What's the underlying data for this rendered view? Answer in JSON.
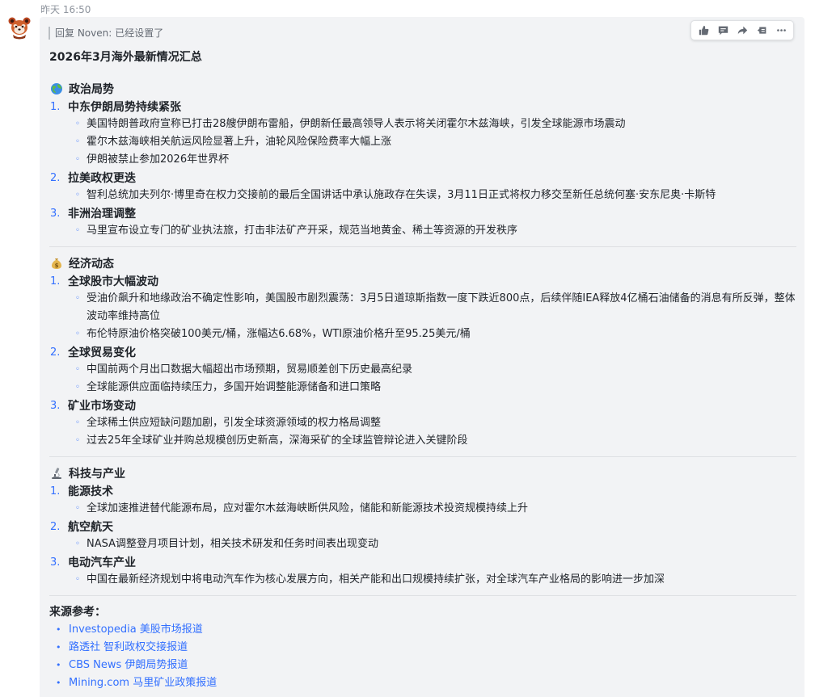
{
  "message": {
    "timestamp": "昨天 16:50",
    "reply_label": "回复 Noven:",
    "reply_text": "已经设置了",
    "title": "2026年3月海外最新情况汇总"
  },
  "toolbar": {
    "icons": [
      "thumbs-up-icon",
      "comment-icon",
      "forward-icon",
      "share-icon",
      "more-icon"
    ]
  },
  "sections": [
    {
      "emoji": "globe-icon",
      "title": "政治局势",
      "topics": [
        {
          "num": "1.",
          "title": "中东伊朗局势持续紧张",
          "bullets": [
            "美国特朗普政府宣称已打击28艘伊朗布雷船，伊朗新任最高领导人表示将关闭霍尔木兹海峡，引发全球能源市场震动",
            "霍尔木兹海峡相关航运风险显著上升，油轮风险保险费率大幅上涨",
            "伊朗被禁止参加2026年世界杯"
          ]
        },
        {
          "num": "2.",
          "title": "拉美政权更迭",
          "bullets": [
            "智利总统加夫列尔·博里奇在权力交接前的最后全国讲话中承认施政存在失误，3月11日正式将权力移交至新任总统何塞·安东尼奥·卡斯特"
          ]
        },
        {
          "num": "3.",
          "title": "非洲治理调整",
          "bullets": [
            "马里宣布设立专门的矿业执法旅，打击非法矿产开采，规范当地黄金、稀土等资源的开发秩序"
          ]
        }
      ]
    },
    {
      "emoji": "money-bag-icon",
      "title": "经济动态",
      "topics": [
        {
          "num": "1.",
          "title": "全球股市大幅波动",
          "bullets": [
            "受油价飙升和地缘政治不确定性影响，美国股市剧烈震荡：3月5日道琼斯指数一度下跌近800点，后续伴随IEA释放4亿桶石油储备的消息有所反弹，整体波动率维持高位",
            "布伦特原油价格突破100美元/桶，涨幅达6.68%，WTI原油价格升至95.25美元/桶"
          ]
        },
        {
          "num": "2.",
          "title": "全球贸易变化",
          "bullets": [
            "中国前两个月出口数据大幅超出市场预期，贸易顺差创下历史最高纪录",
            "全球能源供应面临持续压力，多国开始调整能源储备和进口策略"
          ]
        },
        {
          "num": "3.",
          "title": "矿业市场变动",
          "bullets": [
            "全球稀土供应短缺问题加剧，引发全球资源领域的权力格局调整",
            "过去25年全球矿业并购总规模创历史新高，深海采矿的全球监管辩论进入关键阶段"
          ]
        }
      ]
    },
    {
      "emoji": "microscope-icon",
      "title": "科技与产业",
      "topics": [
        {
          "num": "1.",
          "title": "能源技术",
          "bullets": [
            "全球加速推进替代能源布局，应对霍尔木兹海峡断供风险，储能和新能源技术投资规模持续上升"
          ]
        },
        {
          "num": "2.",
          "title": "航空航天",
          "bullets": [
            "NASA调整登月项目计划，相关技术研发和任务时间表出现变动"
          ]
        },
        {
          "num": "3.",
          "title": "电动汽车产业",
          "bullets": [
            "中国在最新经济规划中将电动汽车作为核心发展方向，相关产能和出口规模持续扩张，对全球汽车产业格局的影响进一步加深"
          ]
        }
      ]
    }
  ],
  "sources": {
    "title": "来源参考：",
    "items": [
      "Investopedia 美股市场报道",
      "路透社 智利政权交接报道",
      "CBS News 伊朗局势报道",
      "Mining.com 马里矿业政策报道"
    ]
  },
  "colors": {
    "accent": "#3370ff",
    "bubble": "#f2f3f5",
    "text": "#1f2329"
  }
}
